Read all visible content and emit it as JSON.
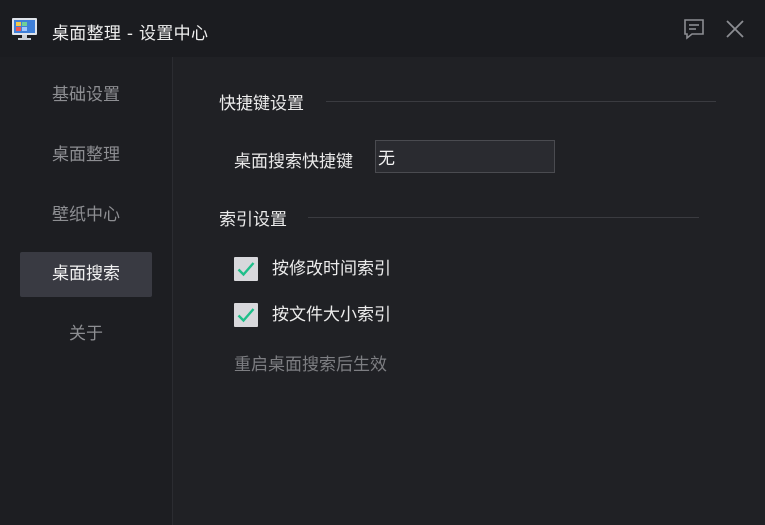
{
  "window": {
    "title": "桌面整理 - 设置中心",
    "icons": [
      "app-monitor-icon",
      "feedback-icon",
      "close-icon"
    ]
  },
  "sidebar": {
    "items": [
      {
        "label": "基础设置",
        "active": false
      },
      {
        "label": "桌面整理",
        "active": false
      },
      {
        "label": "壁纸中心",
        "active": false
      },
      {
        "label": "桌面搜索",
        "active": true
      },
      {
        "label": "关于",
        "active": false
      }
    ]
  },
  "hotkey_section": {
    "title": "快捷键设置",
    "search_hotkey_label": "桌面搜索快捷键",
    "search_hotkey_value": "无"
  },
  "index_section": {
    "title": "索引设置",
    "options": [
      {
        "label": "按修改时间索引",
        "checked": true
      },
      {
        "label": "按文件大小索引",
        "checked": true
      }
    ],
    "note": "重启桌面搜索后生效"
  },
  "colors": {
    "background": "#202125",
    "sidebar_active": "#393a42",
    "checkmark": "#1fbf8a"
  }
}
